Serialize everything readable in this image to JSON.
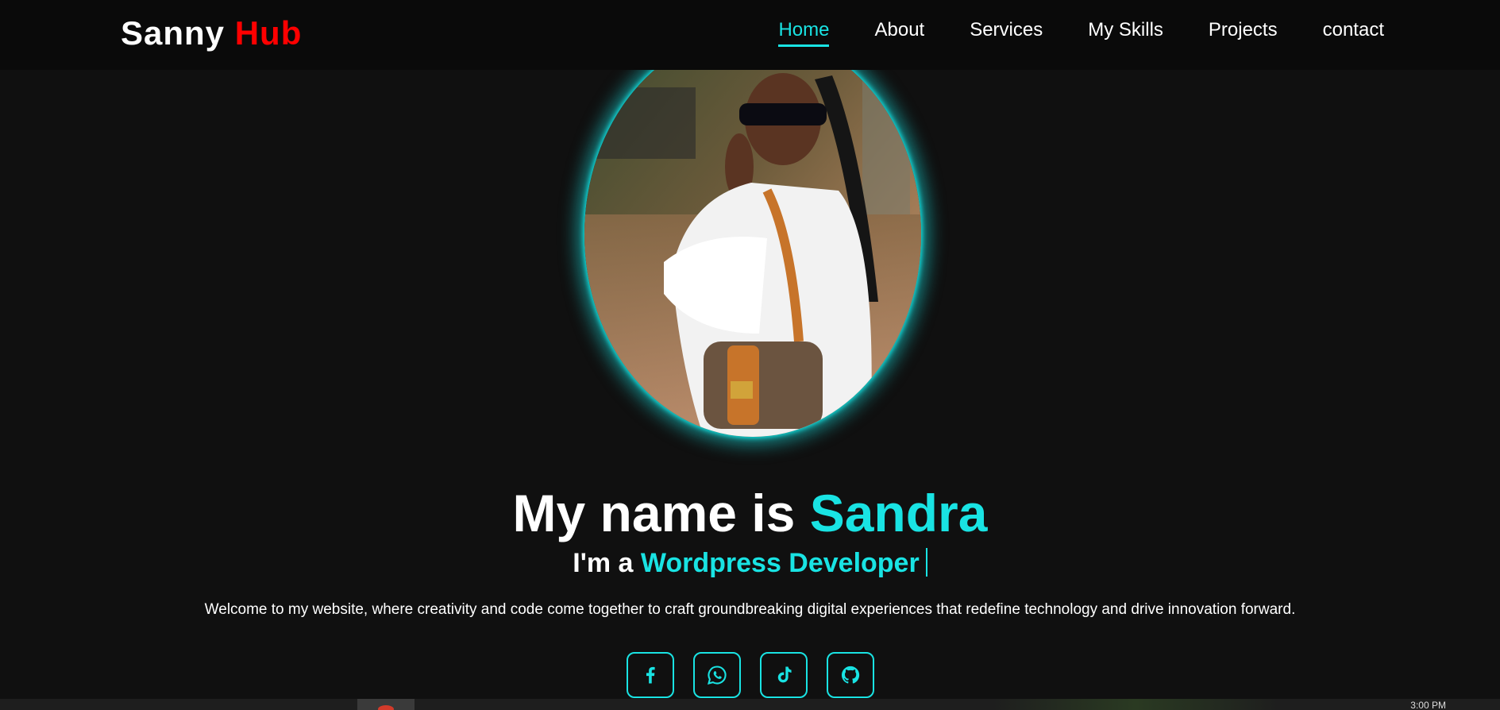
{
  "header": {
    "logo_main": "Sanny",
    "logo_accent": "Hub",
    "nav": [
      {
        "label": "Home",
        "active": true
      },
      {
        "label": "About"
      },
      {
        "label": "Services"
      },
      {
        "label": "My Skills"
      },
      {
        "label": "Projects"
      },
      {
        "label": "contact"
      }
    ]
  },
  "hero": {
    "portrait_icon": "profile-photo",
    "title_prefix": "My name is",
    "title_name": "Sandra",
    "subtitle_prefix": "I'm a",
    "subtitle_role": "Wordpress Developer",
    "welcome": "Welcome to my website, where creativity and code come together to craft groundbreaking digital experiences that redefine technology and drive innovation forward.",
    "socials": [
      {
        "icon": "facebook-icon"
      },
      {
        "icon": "whatsapp-icon"
      },
      {
        "icon": "tiktok-icon"
      },
      {
        "icon": "github-icon"
      }
    ]
  },
  "taskbar": {
    "clock": "3:00 PM"
  },
  "colors": {
    "accent": "#19e3e3",
    "logo_accent": "#ff0000",
    "background": "#101010"
  }
}
